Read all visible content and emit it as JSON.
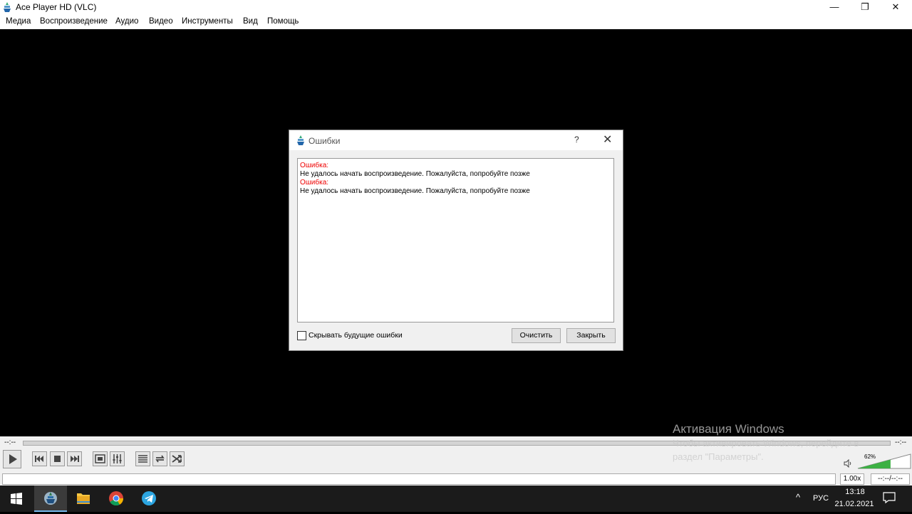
{
  "window": {
    "title": "Ace Player HD (VLC)",
    "minimize": "—",
    "maximize": "❐",
    "close": "✕"
  },
  "menu": [
    "Медиа",
    "Воспроизведение",
    "Аудио",
    "Видео",
    "Инструменты",
    "Вид",
    "Помощь"
  ],
  "dialog": {
    "title": "Ошибки",
    "help": "?",
    "close": "✕",
    "log": [
      {
        "label": "Ошибка:",
        "message": "Не удалось начать воспроизведение. Пожалуйста, попробуйте позже"
      },
      {
        "label": "Ошибка:",
        "message": "Не удалось начать воспроизведение. Пожалуйста, попробуйте позже"
      }
    ],
    "hide_future_label": "Скрывать будущие ошибки",
    "hide_future_checked": false,
    "clear_label": "Очистить",
    "close_label": "Закрыть"
  },
  "player": {
    "time_elapsed": "--:--",
    "time_total": "--:--",
    "volume_label": "62%",
    "volume_level": 0.62,
    "speed": "1.00x",
    "time_display": "--:--/--:--"
  },
  "watermark": {
    "title": "Активация Windows",
    "line1": "Чтобы активировать Windows, перейдите в",
    "line2": "раздел \"Параметры\"."
  },
  "taskbar": {
    "language": "РУС",
    "time": "13:18",
    "date": "21.02.2021",
    "tray_arrow": "^"
  },
  "colors": {
    "error_red": "#e00000",
    "volume_green": "#3cb043",
    "taskbar_bg": "#1b1b1b",
    "active_underline": "#76b9ed"
  }
}
